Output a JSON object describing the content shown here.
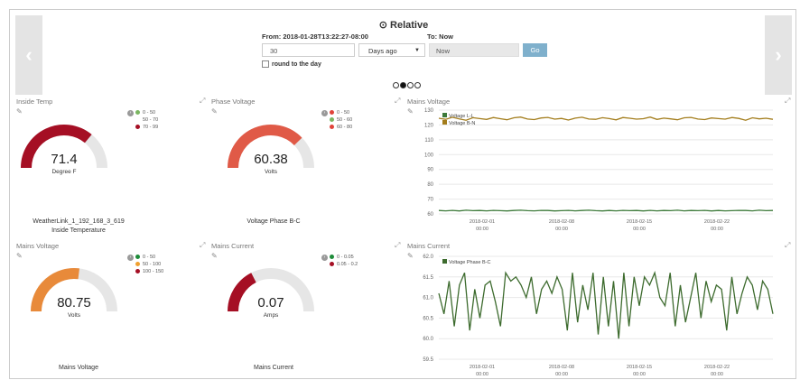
{
  "header": {
    "title": "Relative",
    "from": "From: 2018-01-28T13:22:27-08:00",
    "to": "To: Now",
    "amount": "30",
    "unit": "Days ago",
    "now": "Now",
    "go": "Go",
    "round": "round to the day"
  },
  "gauges": [
    {
      "title": "Inside Temp",
      "value": "71.4",
      "unit": "Degree F",
      "caption1": "WeatherLink_1_192_168_3_619",
      "caption2": "Inside Temperature",
      "legend": [
        {
          "label": "0 - 50",
          "color": "#7bb661"
        },
        {
          "label": "50 - 70",
          "color": "#ffffff"
        },
        {
          "label": "70 - 99",
          "color": "#a50f24"
        }
      ],
      "fraction": 0.72,
      "color": "#a50f24"
    },
    {
      "title": "Phase Voltage",
      "value": "60.38",
      "unit": "Volts",
      "caption1": "Voltage Phase B-C",
      "caption2": "",
      "legend": [
        {
          "label": "0 - 50",
          "color": "#e0443a"
        },
        {
          "label": "50 - 60",
          "color": "#7bb661"
        },
        {
          "label": "60 - 80",
          "color": "#e0443a"
        }
      ],
      "fraction": 0.755,
      "color": "#e05a47"
    },
    {
      "title": "Mains Voltage",
      "value": "80.75",
      "unit": "Volts",
      "caption1": "Mains Voltage",
      "caption2": "",
      "legend": [
        {
          "label": "0 - 50",
          "color": "#1e8c3a"
        },
        {
          "label": "50 - 100",
          "color": "#f0a030"
        },
        {
          "label": "100 - 150",
          "color": "#a50f24"
        }
      ],
      "fraction": 0.54,
      "color": "#e88a3a"
    },
    {
      "title": "Mains Current",
      "value": "0.07",
      "unit": "Amps",
      "caption1": "Mains Current",
      "caption2": "",
      "legend": [
        {
          "label": "0 - 0.05",
          "color": "#1e8c3a"
        },
        {
          "label": "0.05 - 0.2",
          "color": "#a50f24"
        }
      ],
      "fraction": 0.35,
      "color": "#a50f24"
    }
  ],
  "charts": [
    {
      "title": "Mains Voltage"
    },
    {
      "title": "Mains Current"
    }
  ],
  "chart_data": [
    {
      "type": "line",
      "ylim": [
        60,
        130
      ],
      "yticks": [
        "60",
        "70",
        "80",
        "90",
        "100",
        "110",
        "120",
        "130"
      ],
      "xticks": [
        [
          "2018-02-01",
          "00:00"
        ],
        [
          "2018-02-08",
          "00:00"
        ],
        [
          "2018-02-15",
          "00:00"
        ],
        [
          "2018-02-22",
          "00:00"
        ]
      ],
      "series": [
        {
          "name": "Voltage L-L",
          "color": "#3d7a3a",
          "values": [
            62.3,
            62.1,
            62.4,
            62.0,
            62.5,
            62.2,
            62.3,
            62.1,
            62.4,
            62.2,
            62.0,
            62.3,
            62.5,
            62.2,
            62.1,
            62.4,
            62.3,
            62.0,
            62.2,
            62.4,
            62.1,
            62.3,
            62.5,
            62.2,
            62.0,
            62.3,
            62.1,
            62.4,
            62.2,
            62.3,
            62.0,
            62.4,
            62.1,
            62.3,
            62.2,
            62.5,
            62.1,
            62.3,
            62.2,
            62.4,
            62.0,
            62.3,
            62.1,
            62.2,
            62.4,
            62.3,
            62.1,
            62.5,
            62.2,
            62.3
          ]
        },
        {
          "name": "Voltage B-N",
          "color": "#a37d1c",
          "values": [
            124.5,
            123.8,
            125.2,
            124.1,
            123.2,
            124.9,
            124.3,
            123.7,
            125.0,
            124.2,
            123.5,
            124.8,
            125.3,
            124.0,
            123.6,
            124.7,
            125.1,
            123.9,
            124.4,
            123.3,
            124.6,
            125.2,
            124.0,
            123.8,
            124.9,
            124.3,
            123.4,
            125.0,
            124.5,
            123.9,
            124.2,
            125.3,
            123.7,
            124.6,
            124.1,
            123.5,
            124.8,
            125.1,
            124.0,
            123.6,
            124.7,
            124.3,
            123.9,
            125.0,
            124.4,
            123.2,
            124.8,
            124.1,
            124.5,
            123.8
          ]
        }
      ]
    },
    {
      "type": "line",
      "ylim": [
        59.5,
        62.0
      ],
      "yticks": [
        "59.5",
        "60.0",
        "60.5",
        "61.0",
        "61.5",
        "62.0"
      ],
      "xticks": [
        [
          "2018-02-01",
          "00:00"
        ],
        [
          "2018-02-08",
          "00:00"
        ],
        [
          "2018-02-15",
          "00:00"
        ],
        [
          "2018-02-22",
          "00:00"
        ]
      ],
      "series": [
        {
          "name": "Voltage Phase B-C",
          "color": "#3d6b2e",
          "values": [
            61.1,
            60.6,
            61.4,
            60.3,
            61.3,
            61.6,
            60.2,
            61.2,
            60.5,
            61.3,
            61.4,
            60.9,
            60.3,
            61.6,
            61.4,
            61.5,
            61.3,
            61.0,
            61.5,
            60.6,
            61.2,
            61.4,
            61.1,
            61.5,
            61.2,
            60.2,
            61.6,
            60.4,
            61.3,
            60.7,
            61.6,
            60.1,
            61.5,
            60.3,
            61.4,
            60.0,
            61.6,
            60.3,
            61.5,
            60.8,
            61.5,
            61.3,
            61.6,
            61.0,
            60.8,
            61.6,
            60.3,
            61.3,
            60.4,
            61.0,
            61.6,
            60.5,
            61.4,
            60.9,
            61.3,
            61.2,
            60.2,
            61.5,
            60.6,
            61.1,
            61.5,
            61.3,
            60.7,
            61.4,
            61.2,
            60.6
          ]
        }
      ]
    }
  ]
}
